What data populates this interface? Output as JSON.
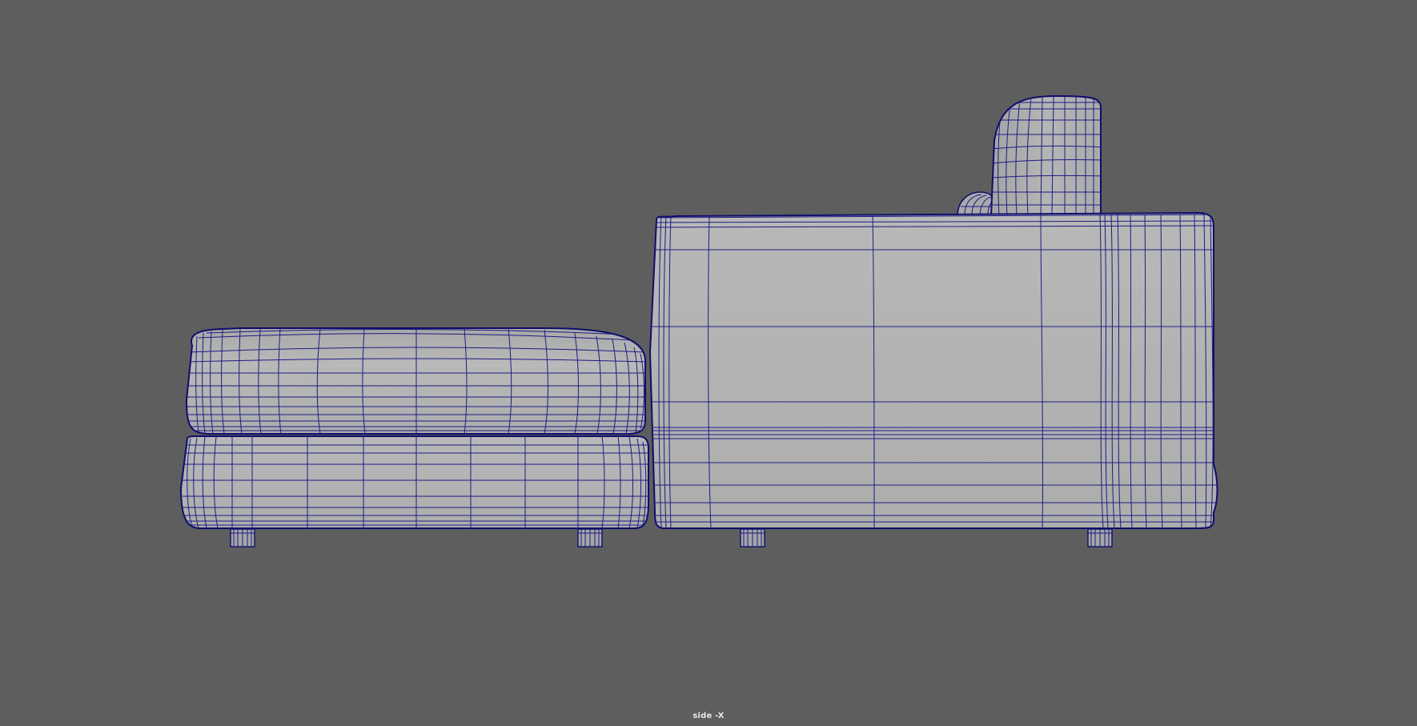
{
  "viewport": {
    "camera_label": "side -X",
    "background_color": "#5e5e5e",
    "shading": "smooth-shaded-with-wireframe",
    "wire_color": "#1a1a7a",
    "surface_color": "#b3b3b3"
  },
  "scene": {
    "objects": [
      "ottoman-top-cushion",
      "ottoman-bottom-cushion",
      "sofa-main-body",
      "sofa-back-cushion",
      "sofa-small-pillow",
      "leg-1",
      "leg-2",
      "leg-3",
      "leg-4"
    ]
  }
}
